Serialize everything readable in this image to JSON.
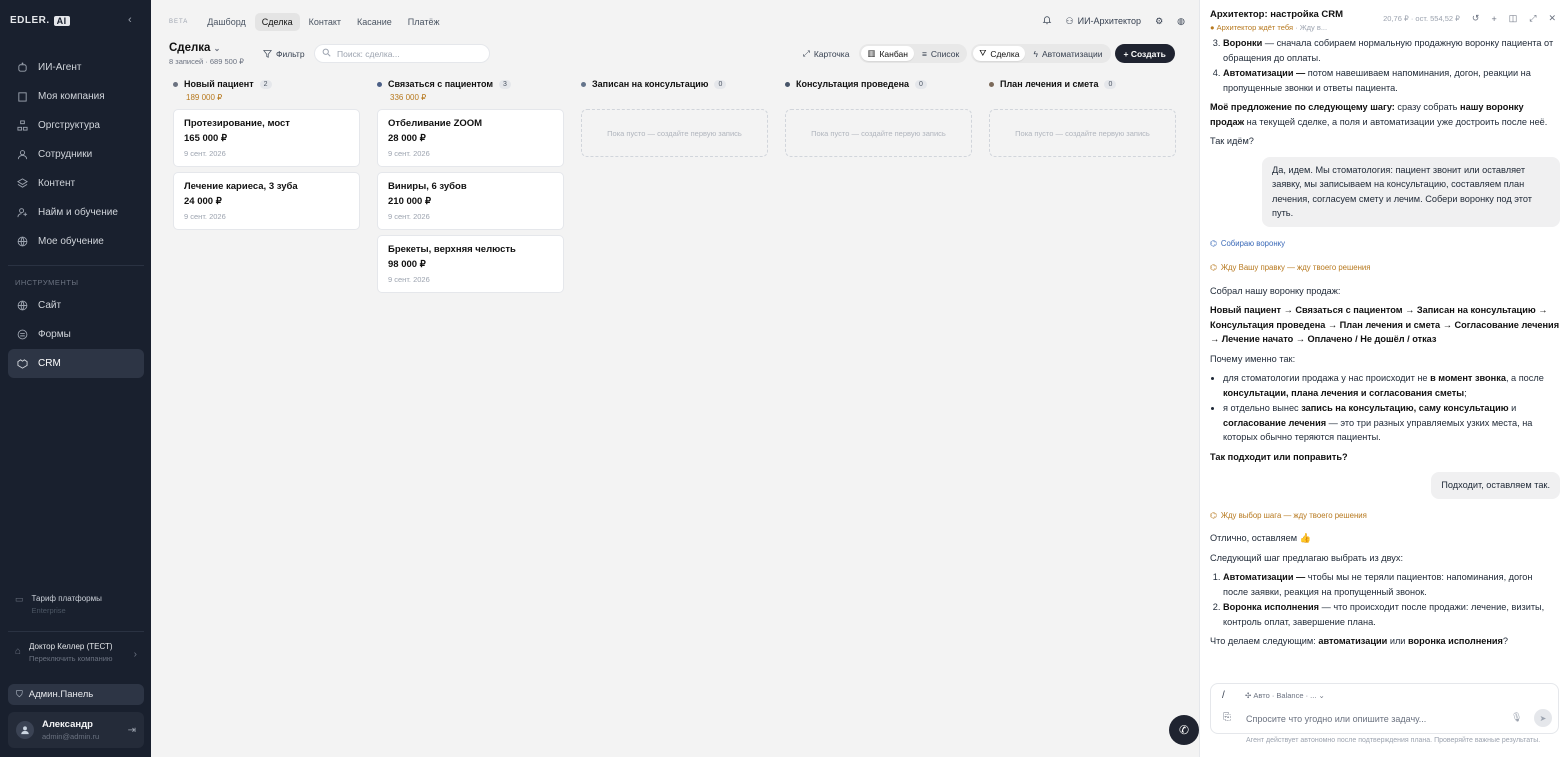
{
  "sidebar": {
    "logo": "EDLER.",
    "logo_badge": "AI",
    "nav": [
      {
        "label": "ИИ-Агент",
        "icon": "robot-icon"
      },
      {
        "label": "Моя компания",
        "icon": "building-icon"
      },
      {
        "label": "Оргструктура",
        "icon": "org-icon"
      },
      {
        "label": "Сотрудники",
        "icon": "users-icon"
      },
      {
        "label": "Контент",
        "icon": "layers-icon"
      },
      {
        "label": "Найм и обучение",
        "icon": "hire-icon"
      },
      {
        "label": "Мое обучение",
        "icon": "globe-icon"
      }
    ],
    "tools_label": "ИНСТРУМЕНТЫ",
    "tools": [
      {
        "label": "Сайт",
        "icon": "globe-icon"
      },
      {
        "label": "Формы",
        "icon": "form-icon"
      },
      {
        "label": "CRM",
        "icon": "crm-icon",
        "active": true
      }
    ],
    "plan_title": "Тариф платформы",
    "plan_value": "Enterprise",
    "company_name": "Доктор Келлер (ТЕСТ)",
    "company_switch": "Переключить компанию",
    "admin": "Админ.Панель",
    "user_name": "Александр",
    "user_email": "admin@admin.ru"
  },
  "topbar": {
    "beta": "BETA",
    "tabs": [
      "Дашборд",
      "Сделка",
      "Контакт",
      "Касание",
      "Платёж"
    ],
    "active_tab": 1,
    "agent": "ИИ-Архитектор"
  },
  "header": {
    "title": "Сделка",
    "subtitle": "8 записей · 689 500 ₽",
    "filter": "Фильтр",
    "search_placeholder": "Поиск: сделка..."
  },
  "views": {
    "card": "Карточка",
    "kanban": "Канбан",
    "list": "Список",
    "deal": "Сделка",
    "automations": "Автоматизации",
    "create": "+ Создать"
  },
  "columns": [
    {
      "name": "Новый пациент",
      "count": "2",
      "sum": "189 000 ₽",
      "color": "#6b7280",
      "cards": [
        {
          "title": "Протезирование, мост",
          "amount": "165 000 ₽",
          "date": "9 сент. 2026"
        },
        {
          "title": "Лечение кариеса, 3 зуба",
          "amount": "24 000 ₽",
          "date": "9 сент. 2026"
        }
      ]
    },
    {
      "name": "Связаться с пациентом",
      "count": "3",
      "sum": "336 000 ₽",
      "color": "#4b5f86",
      "cards": [
        {
          "title": "Отбеливание ZOOM",
          "amount": "28 000 ₽",
          "date": "9 сент. 2026"
        },
        {
          "title": "Виниры, 6 зубов",
          "amount": "210 000 ₽",
          "date": "9 сент. 2026"
        },
        {
          "title": "Брекеты, верхняя челюсть",
          "amount": "98 000 ₽",
          "date": "9 сент. 2026"
        }
      ]
    },
    {
      "name": "Записан на консультацию",
      "count": "0",
      "color": "#64748b",
      "empty": "Пока пусто — создайте первую запись"
    },
    {
      "name": "Консультация проведена",
      "count": "0",
      "color": "#475569",
      "empty": "Пока пусто — создайте первую запись"
    },
    {
      "name": "План лечения и смета",
      "count": "0",
      "color": "#7c6a5a",
      "empty": "Пока пусто — создайте первую запись"
    }
  ],
  "panel": {
    "title": "Архитектор: настройка CRM",
    "status": "Архитектор ждёт тебя",
    "status_suffix": "· Жду в...",
    "cost": "20,76 ₽",
    "cost_rest": "ост. 554,52 ₽",
    "intro_items": [
      {
        "bold": "Воронки",
        "text": " — сначала собираем нормальную продажную воронку пациента от обращения до оплаты."
      },
      {
        "bold": "Автоматизации —",
        "text": " потом навешиваем напоминания, догон, реакции на пропущенные звонки и ответы пациента."
      }
    ],
    "proposal_bold": "Моё предложение по следующему шагу:",
    "proposal_mid": " сразу собрать ",
    "proposal_bold2": "нашу воронку продаж",
    "proposal_end": " на текущей сделке, а поля и автоматизации уже достроить после неё.",
    "go": "Так идём?",
    "user_msg1": "Да, идем. Мы стоматология: пациент звонит или оставляет заявку, мы записываем на консультацию, составляем план лечения, согласуем смету и лечим. Собери воронку под этот путь.",
    "sys1": "Собираю воронку",
    "sys2": "Жду Вашу правку — жду твоего решения",
    "built": "Собрал нашу воронку продаж:",
    "pipeline": "Новый пациент → Связаться с пациентом → Записан на консультацию → Консультация проведена → План лечения и смета → Согласование лечения → Лечение начато → Оплачено / Не дошёл / отказ",
    "why": "Почему именно так:",
    "why1_a": "для стоматологии продажа у нас происходит не ",
    "why1_b": "в момент звонка",
    "why1_c": ", а после ",
    "why1_d": "консультации, плана лечения и согласования сметы",
    "why1_e": ";",
    "why2_a": "я отдельно вынес ",
    "why2_b": "запись на консультацию, саму консультацию",
    "why2_c": " и ",
    "why2_d": "согласование лечения",
    "why2_e": " — это три разных управляемых узких места, на которых обычно теряются пациенты.",
    "fit": "Так подходит или поправить?",
    "user_msg2": "Подходит, оставляем так.",
    "sys3": "Жду выбор шага — жду твоего решения",
    "ok": "Отлично, оставляем 👍",
    "next": "Следующий шаг предлагаю выбрать из двух:",
    "opt1_b": "Автоматизации —",
    "opt1_t": " чтобы мы не теряли пациентов: напоминания, догон после заявки, реакция на пропущенный звонок.",
    "opt2_b": "Воронка исполнения",
    "opt2_t": " — что происходит после продажи: лечение, визиты, контроль оплат, завершение плана.",
    "q_a": "Что делаем следующим: ",
    "q_b": "автоматизации",
    "q_c": " или ",
    "q_d": "воронка исполнения",
    "q_e": "?",
    "slash": "/",
    "model": "Авто · Balance · ...",
    "input_placeholder": "Спросите что угодно или опишите задачу...",
    "disclaimer": "Агент действует автономно после подтверждения плана. Проверяйте важные результаты."
  }
}
